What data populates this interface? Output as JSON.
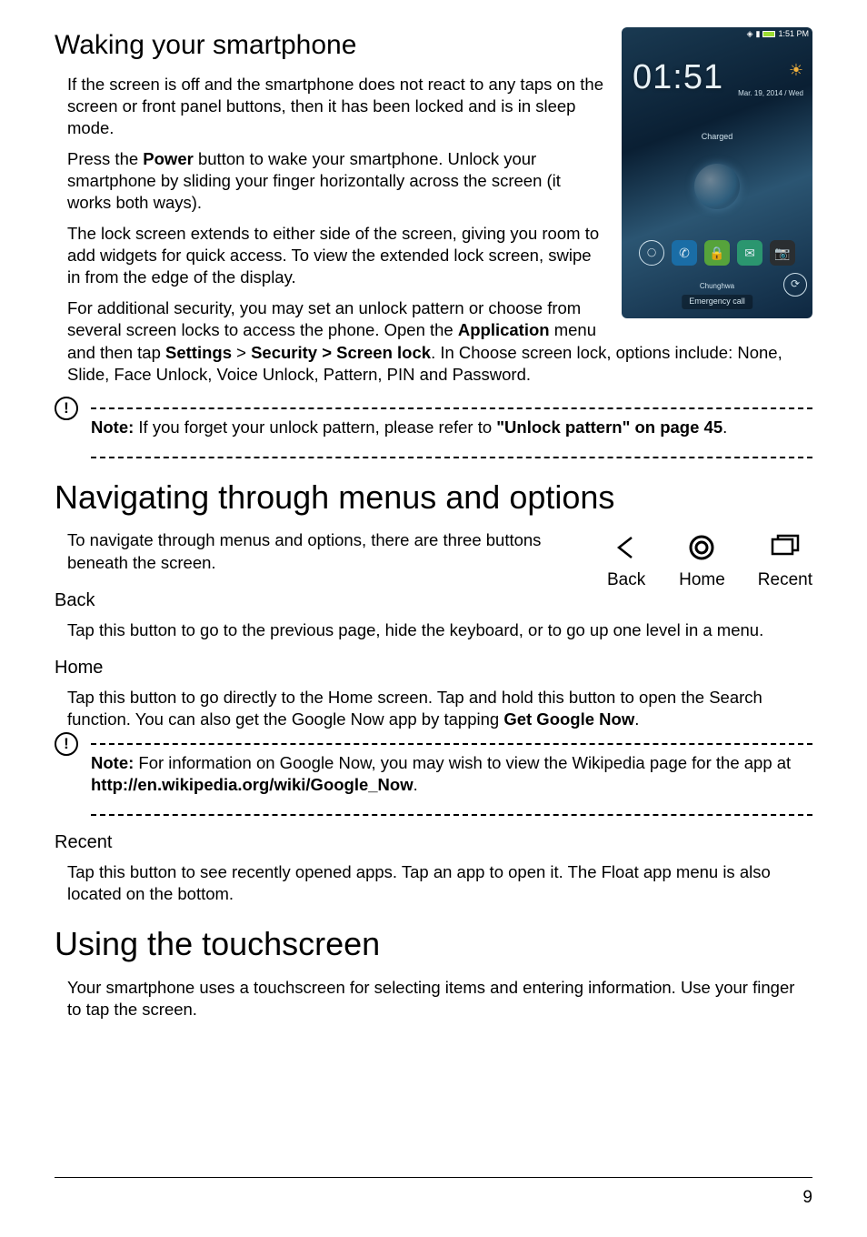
{
  "section1": {
    "title": "Waking your smartphone",
    "p1": "If the screen is off and the smartphone does not react to any taps on the screen or front panel buttons, then it has been locked and is in sleep mode.",
    "p2_pre": "Press the ",
    "p2_b1": "Power",
    "p2_post": " button to wake your smartphone. Unlock your smartphone by sliding your finger horizontally across the screen (it works both ways).",
    "p3": "The lock screen extends to either side of the screen, giving you room to add widgets for quick access. To view the extended lock screen, swipe in from the edge of the display.",
    "p4_pre": "For additional security, you may set an unlock pattern or choose from several screen locks to access the phone. Open the ",
    "p4_b_app": "Application",
    "p4_mid1": " menu and then tap ",
    "p4_b_settings": "Settings",
    "p4_gt": " > ",
    "p4_b_sec": "Security > Screen lock",
    "p4_tail": ". In Choose screen lock, options include: None, Slide, Face Unlock, Voice Unlock, Pattern, PIN and Password."
  },
  "note1": {
    "b_note": "Note:",
    "t1": " If you forget your unlock pattern, please refer to ",
    "b_link": "\"Unlock pattern\" on page 45",
    "t2": "."
  },
  "section2": {
    "title": "Navigating through menus and options",
    "intro": "To navigate through menus and options, there are three buttons beneath the screen.",
    "buttons": {
      "back": "Back",
      "home": "Home",
      "recent": "Recent"
    }
  },
  "back_sub": {
    "title": "Back",
    "p": "Tap this button to go to the previous page, hide the keyboard, or to go up one level in a menu."
  },
  "home_sub": {
    "title": "Home",
    "p_pre": "Tap this button to go directly to the Home screen. Tap and hold this button to open the Search function. You can also get the Google Now app by tapping ",
    "p_b": "Get Google Now",
    "p_post": "."
  },
  "note2": {
    "b_note": "Note:",
    "t1": " For information on Google Now, you may wish to view the Wikipedia page for the app at ",
    "b_link": "http://en.wikipedia.org/wiki/Google_Now",
    "t2": "."
  },
  "recent_sub": {
    "title": "Recent",
    "p": "Tap this button to see recently opened apps. Tap an app to open it. The Float app menu is also located on the bottom."
  },
  "section3": {
    "title": "Using the touchscreen",
    "p": "Your smartphone uses a touchscreen for selecting items and entering information. Use your finger to tap the screen."
  },
  "page_number": "9",
  "lockscreen": {
    "time": "01:51",
    "status_time": "1:51 PM",
    "date": "Mar. 19, 2014 / Wed",
    "charged": "Charged",
    "carrier": "Chunghwa",
    "emergency": "Emergency call"
  }
}
